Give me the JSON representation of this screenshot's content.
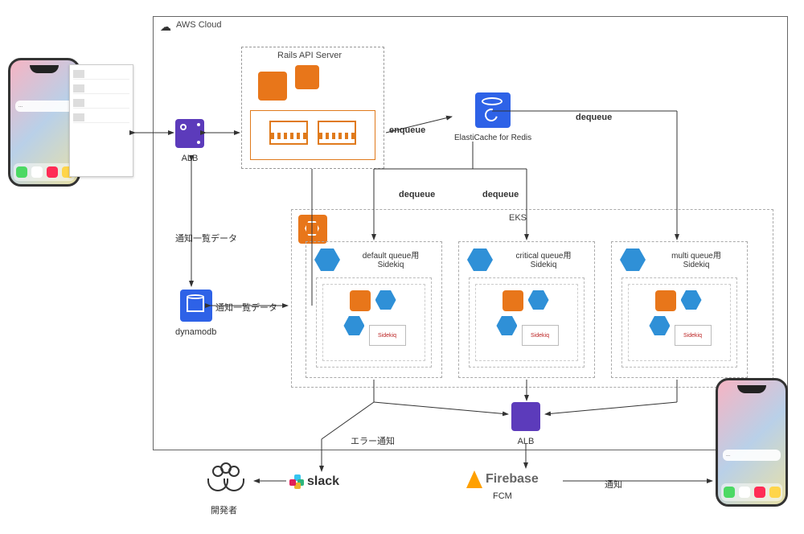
{
  "cloud": {
    "title": "AWS Cloud"
  },
  "rails": {
    "title": "Rails API Server"
  },
  "alb1": {
    "label": "ALB"
  },
  "redis": {
    "label": "ElastiCache for Redis"
  },
  "dynamo": {
    "label": "dynamodb"
  },
  "eks": {
    "title": "EKS"
  },
  "sidekiq": {
    "default": {
      "title": "default queue用",
      "sub": "Sidekiq",
      "badge": "Sidekiq"
    },
    "critical": {
      "title": "critical queue用",
      "sub": "Sidekiq",
      "badge": "Sidekiq"
    },
    "multi": {
      "title": "multi queue用",
      "sub": "Sidekiq",
      "badge": "Sidekiq"
    }
  },
  "alb2": {
    "label": "ALB"
  },
  "slack": {
    "label": "slack"
  },
  "firebase": {
    "label": "Firebase",
    "sub": "FCM"
  },
  "developers": {
    "label": "開発者"
  },
  "edges": {
    "enqueue": "enqueue",
    "dequeue1": "dequeue",
    "dequeue2": "dequeue",
    "dequeue3": "dequeue",
    "notif_list_1": "通知一覧データ",
    "notif_list_2": "通知一覧データ",
    "error_notif": "エラー通知",
    "push_notif": "通知"
  }
}
